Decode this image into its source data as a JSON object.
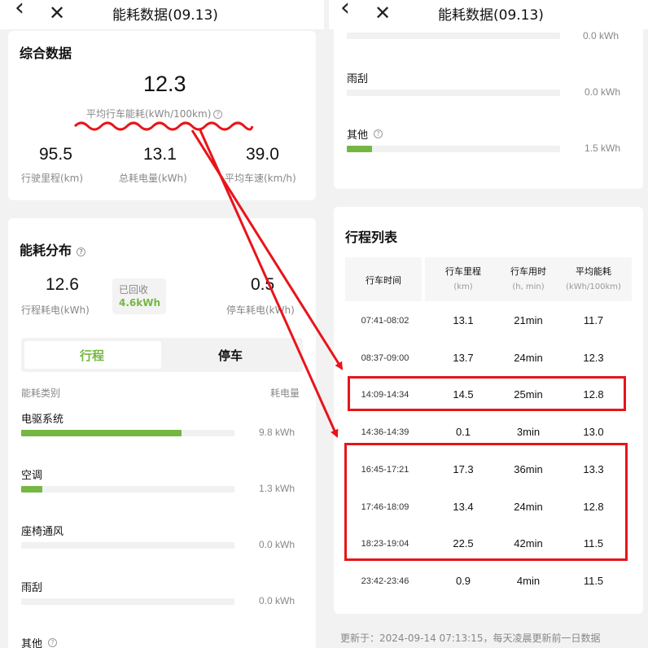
{
  "left": {
    "nav": {
      "back": "‹",
      "close": "✕",
      "title": "能耗数据(09.13)"
    },
    "summary": {
      "title": "综合数据",
      "avg_value": "12.3",
      "avg_label": "平均行车能耗(kWh/100km)",
      "help": "?",
      "stats": [
        {
          "value": "95.5",
          "label": "行驶里程(km)"
        },
        {
          "value": "13.1",
          "label": "总耗电量(kWh)"
        },
        {
          "value": "39.0",
          "label": "平均车速(km/h)"
        }
      ]
    },
    "distribution": {
      "title": "能耗分布",
      "help": "?",
      "drive": {
        "value": "12.6",
        "label": "行程耗电(kWh)"
      },
      "recovered": {
        "label": "已回收",
        "value": "4.6kWh"
      },
      "park": {
        "value": "0.5",
        "label": "停车耗电(kWh)"
      },
      "tabs": [
        "行程",
        "停车"
      ],
      "col_category": "能耗类别",
      "col_energy": "耗电量",
      "categories": [
        {
          "name": "电驱系统",
          "value": "9.8 kWh",
          "fraction": 0.75
        },
        {
          "name": "空调",
          "value": "1.3 kWh",
          "fraction": 0.1
        },
        {
          "name": "座椅通风",
          "value": "0.0 kWh",
          "fraction": 0
        },
        {
          "name": "雨刮",
          "value": "0.0 kWh",
          "fraction": 0
        },
        {
          "name": "其他",
          "value": "",
          "fraction": 0
        }
      ]
    }
  },
  "right": {
    "nav": {
      "back": "‹",
      "close": "✕",
      "title": "能耗数据(09.13)"
    },
    "top_partial_value": "0.0 kWh",
    "categories": [
      {
        "name": "雨刮",
        "value": "0.0 kWh",
        "fraction": 0
      },
      {
        "name": "其他",
        "value": "1.5 kWh",
        "fraction": 0.12
      }
    ],
    "trips": {
      "title": "行程列表",
      "headers": [
        {
          "label": "行车时间",
          "unit": ""
        },
        {
          "label": "行车里程",
          "unit": "(km)"
        },
        {
          "label": "行车用时",
          "unit": "(h, min)"
        },
        {
          "label": "平均能耗",
          "unit": "(kWh/100km)"
        }
      ],
      "rows": [
        {
          "time": "07:41-08:02",
          "distance": "13.1",
          "duration": "21min",
          "avg": "11.7"
        },
        {
          "time": "08:37-09:00",
          "distance": "13.7",
          "duration": "24min",
          "avg": "12.3"
        },
        {
          "time": "14:09-14:34",
          "distance": "14.5",
          "duration": "25min",
          "avg": "12.8"
        },
        {
          "time": "14:36-14:39",
          "distance": "0.1",
          "duration": "3min",
          "avg": "13.0"
        },
        {
          "time": "16:45-17:21",
          "distance": "17.3",
          "duration": "36min",
          "avg": "13.3"
        },
        {
          "time": "17:46-18:09",
          "distance": "13.4",
          "duration": "24min",
          "avg": "12.8"
        },
        {
          "time": "18:23-19:04",
          "distance": "22.5",
          "duration": "42min",
          "avg": "11.5"
        },
        {
          "time": "23:42-23:46",
          "distance": "0.9",
          "duration": "4min",
          "avg": "11.5"
        }
      ]
    },
    "footer": "更新于：2024-09-14 07:13:15，每天凌晨更新前一日数据"
  },
  "colors": {
    "accent": "#76b743",
    "annotation": "#e8141a"
  }
}
